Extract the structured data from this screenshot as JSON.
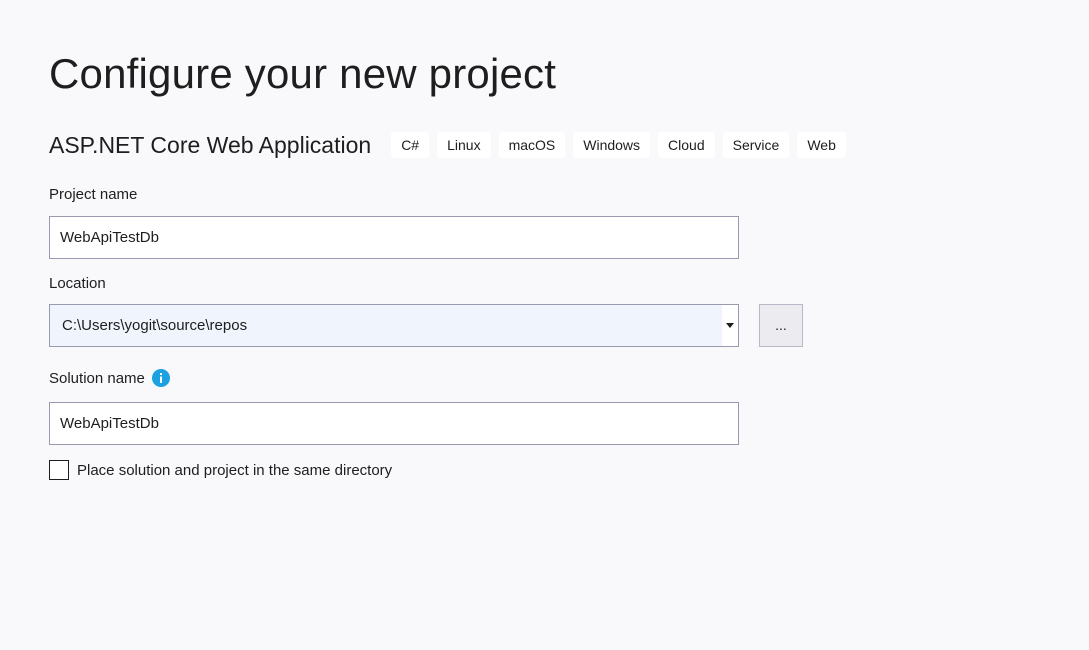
{
  "page": {
    "title": "Configure your new project"
  },
  "template": {
    "name": "ASP.NET Core Web Application",
    "tags": [
      "C#",
      "Linux",
      "macOS",
      "Windows",
      "Cloud",
      "Service",
      "Web"
    ]
  },
  "project_name": {
    "label": "Project name",
    "value": "WebApiTestDb"
  },
  "location": {
    "label": "Location",
    "value": "C:\\Users\\yogit\\source\\repos",
    "browse_label": "..."
  },
  "solution_name": {
    "label": "Solution name",
    "value": "WebApiTestDb",
    "info_icon": "info-icon"
  },
  "same_directory": {
    "label": "Place solution and project in the same directory",
    "checked": false
  },
  "colors": {
    "background": "#f9f9fb",
    "text": "#1e1e1e",
    "field_border": "#9a9aae",
    "combo_background": "#f0f4fc",
    "info_accent": "#1ba1e2"
  }
}
